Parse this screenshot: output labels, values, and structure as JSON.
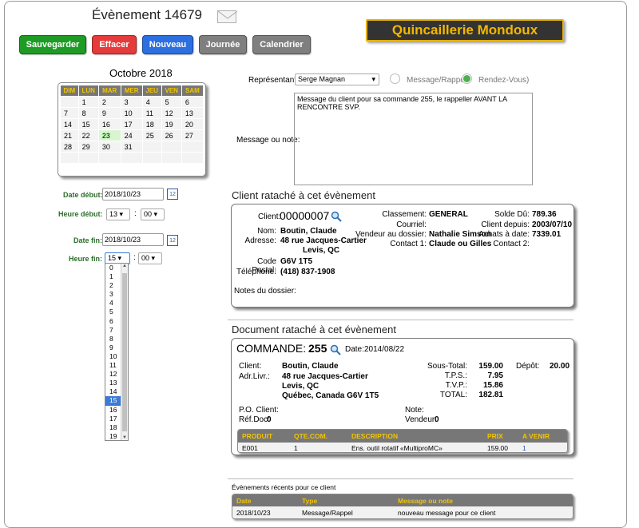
{
  "header": {
    "title": "Évènement 14679",
    "logo_text": "Quincaillerie Mondoux",
    "mail_icon": "envelope-icon"
  },
  "toolbar": {
    "save": "Sauvegarder",
    "delete": "Effacer",
    "new": "Nouveau",
    "day": "Journée",
    "calendar": "Calendrier",
    "colors": {
      "save": "#1e9b24",
      "delete": "#e53b3b",
      "new": "#2c6fe0",
      "day": "#7f7f7f",
      "calendar": "#7f7f7f"
    }
  },
  "calendar": {
    "month_label": "Octobre 2018",
    "days": [
      "DIM",
      "LUN",
      "MAR",
      "MER",
      "JEU",
      "VEN",
      "SAM"
    ],
    "weeks": [
      [
        "",
        "1",
        "2",
        "3",
        "4",
        "5",
        "6"
      ],
      [
        "7",
        "8",
        "9",
        "10",
        "11",
        "12",
        "13"
      ],
      [
        "14",
        "15",
        "16",
        "17",
        "18",
        "19",
        "20"
      ],
      [
        "21",
        "22",
        "23",
        "24",
        "25",
        "26",
        "27"
      ],
      [
        "28",
        "29",
        "30",
        "31",
        "",
        "",
        ""
      ],
      [
        "",
        "",
        "",
        "",
        "",
        "",
        ""
      ]
    ],
    "today": "23"
  },
  "dates": {
    "start_label": "Date début:",
    "start_value": "2018/10/23",
    "start_time_label": "Heure début:",
    "start_hour": "13",
    "start_min": "00",
    "end_label": "Date fin:",
    "end_value": "2018/10/23",
    "end_time_label": "Heure fin:",
    "end_hour": "15",
    "end_min": "00",
    "hour_options": [
      "0",
      "1",
      "2",
      "3",
      "4",
      "5",
      "6",
      "7",
      "8",
      "9",
      "10",
      "11",
      "12",
      "13",
      "14",
      "15",
      "16",
      "17",
      "18",
      "19"
    ],
    "selected_hour": "15"
  },
  "form": {
    "rep_label": "Représentant:",
    "rep_value": "Serge Magnan",
    "radio_message": "Message/Rappel",
    "radio_rdv": "Rendez-Vous)",
    "note_label": "Message ou note:",
    "note_value": "Message du client pour sa commande 255, le rappeller AVANT LA RENCONTRE SVP."
  },
  "client": {
    "section_title": "Client rataché à cet évènement",
    "client_label": "Client:",
    "client_number": "00000007",
    "name_label": "Nom:",
    "name": "Boutin, Claude",
    "address_label": "Adresse:",
    "address1": "48 rue Jacques-Cartier",
    "address2": "Levis, QC",
    "postal_label": "Code Postal:",
    "postal": "G6V 1T5",
    "phone_label": "Téléphone:",
    "phone": "(418) 837-1908",
    "class_label": "Classement:",
    "class_value": "GENERAL",
    "email_label": "Courriel:",
    "seller_label": "Vendeur au dossier:",
    "seller": "Nathalie Simson",
    "contact1_label": "Contact 1:",
    "contact1": "Claude ou Gilles",
    "balance_label": "Solde Dû:",
    "balance": "789.36",
    "since_label": "Client depuis:",
    "since": "2003/07/10",
    "purchases_label": "Achats à date:",
    "purchases": "7339.01",
    "contact2_label": "Contact 2:",
    "notes_label": "Notes du dossier:"
  },
  "document": {
    "section_title": "Document rataché à cet évènement",
    "doc_title": "COMMANDE:",
    "doc_number": "255",
    "date_label": "Date:",
    "date": "2014/08/22",
    "client_label": "Client:",
    "client": "Boutin, Claude",
    "addr_label": "Adr.Livr.:",
    "addr1": "48 rue Jacques-Cartier",
    "addr2": "Levis, QC",
    "addr3": "Québec, Canada G6V 1T5",
    "subtotal_label": "Sous-Total:",
    "subtotal": "159.00",
    "tps_label": "T.P.S.:",
    "tps": "7.95",
    "tvp_label": "T.V.P.:",
    "tvp": "15.86",
    "total_label": "TOTAL:",
    "total": "182.81",
    "deposit_label": "Dépôt:",
    "deposit": "20.00",
    "po_label": "P.O. Client:",
    "ref_label": "Réf.Doc:",
    "ref": "0",
    "note_label": "Note:",
    "seller_label": "Vendeur:",
    "seller": "0",
    "table_headers": [
      "PRODUIT",
      "QTE.COM.",
      "DESCRIPTION",
      "PRIX",
      "A VENIR"
    ],
    "rows": [
      [
        "E001",
        "1",
        "Ens. outil rotatif «MultiproMC»",
        "159.00",
        "1"
      ]
    ]
  },
  "recent": {
    "title": "Évènements récents pour ce client",
    "headers": [
      "Date",
      "Type",
      "Message ou note"
    ],
    "rows": [
      [
        "2018/10/23",
        "Message/Rappel",
        "nouveau message pour ce client"
      ]
    ]
  }
}
